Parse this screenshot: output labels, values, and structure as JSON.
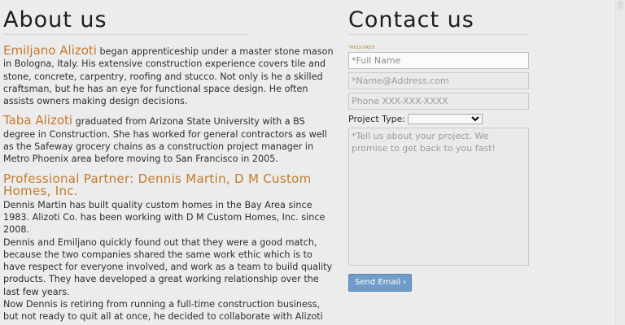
{
  "about": {
    "title": "About us",
    "p1_name": "Emiljano Alizoti",
    "p1_text": " began apprenticeship under a master stone mason in Bologna, Italy. His extensive construction experience covers tile and stone, concrete, carpentry, roofing and stucco. Not only is he a skilled craftsman, but he has an eye for functional space design. He often assists owners making design decisions.",
    "p2_name": "Taba Alizoti",
    "p2_text": " graduated from Arizona State University with a BS degree in Construction. She has worked for general contractors as well as the Safeway grocery chains as a construction project manager in Metro Phoenix area before moving to San Francisco in 2005.",
    "partner_heading": "Professional Partner: Dennis Martin, D M Custom Homes, Inc.",
    "p3_text": "Dennis Martin has built quality custom homes in the Bay Area since 1983. Alizoti Co. has been working with D M Custom Homes, Inc. since 2008.",
    "p4_text": "Dennis and Emiljano quickly found out that they were a good match, because the two companies shared the same work ethic which is to have respect for everyone involved, and work as a team to build quality products. They have developed a great working relationship over the last few years.",
    "p5_text": "Now Dennis is retiring from running a full-time construction business, but not ready to quit all at once, he decided to collaborate with Alizoti"
  },
  "contact": {
    "title": "Contact us",
    "required_label": "*Required",
    "name_placeholder": "*Full Name",
    "email_placeholder": "*Name@Address.com",
    "phone_placeholder": "Phone XXX-XXX-XXXX",
    "project_type_label": "Project Type:",
    "project_type_selected": "",
    "message_placeholder": "*Tell us about your project. We promise to get back to you fast!",
    "send_label": "Send Email",
    "send_icon": "chevron-right-icon"
  }
}
